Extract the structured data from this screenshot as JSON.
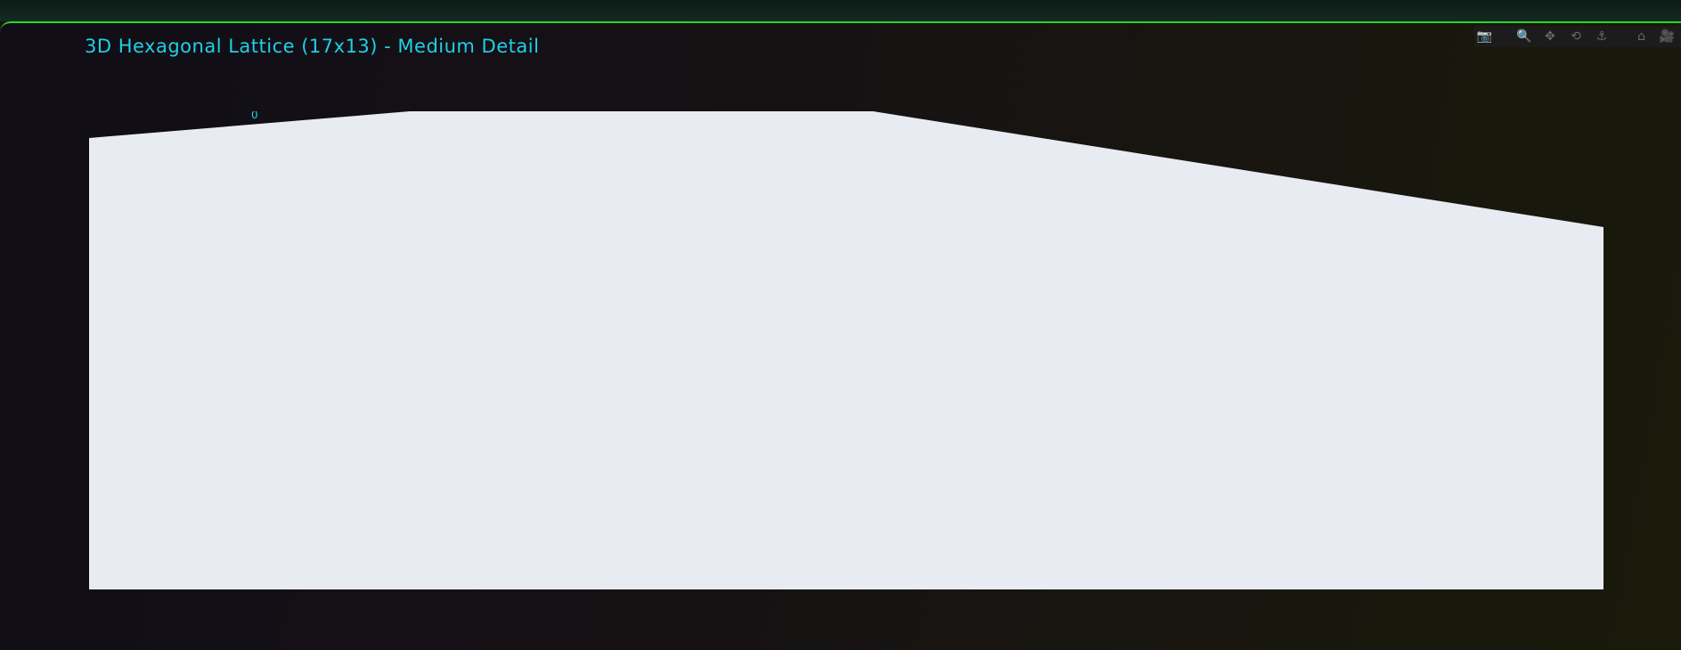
{
  "chart": {
    "title": "3D Hexagonal Lattice (17x13) - Medium Detail",
    "axis_tick_label": "0"
  },
  "chart_data": {
    "type": "3d-surface",
    "title": "3D Hexagonal Lattice (17x13) - Medium Detail",
    "lattice": {
      "columns": 17,
      "rows": 13,
      "cell_shape": "hexagonal prism",
      "detail": "Medium"
    },
    "grid": true,
    "palette": [
      "#a83fd8",
      "#3fbf6a",
      "#4d7fd8",
      "#d84a9a",
      "#e84a4a",
      "#8ea853",
      "#b98a5a",
      "#3cc7b5",
      "#8a5ad8"
    ],
    "edge_color": "#ff2a2a"
  },
  "modebar": {
    "icons": [
      {
        "name": "camera-icon",
        "glyph": "📷"
      },
      {
        "name": "zoom-icon",
        "glyph": "🔍"
      },
      {
        "name": "pan-icon",
        "glyph": "✥"
      },
      {
        "name": "orbit-rotation-icon",
        "glyph": "⟲"
      },
      {
        "name": "turntable-rotation-icon",
        "glyph": "⚓"
      },
      {
        "name": "reset-camera-home-icon",
        "glyph": "⌂"
      },
      {
        "name": "reset-camera-last-save-icon",
        "glyph": "🎥"
      }
    ]
  }
}
